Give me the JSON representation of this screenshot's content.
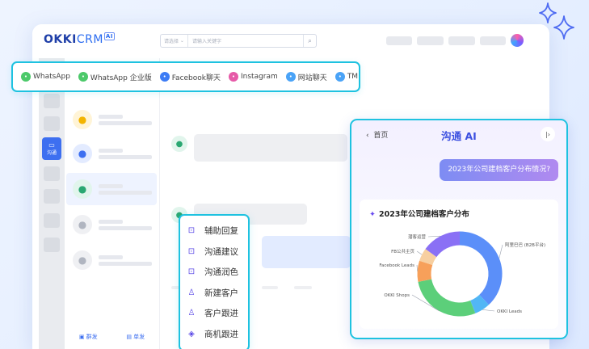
{
  "app": {
    "logo_main": "OKKI",
    "logo_suffix": "CRM",
    "logo_badge": "AI",
    "search": {
      "select_label": "请选择",
      "placeholder": "请输入关键字"
    }
  },
  "sidebar": {
    "active_label": "沟通"
  },
  "list_footer": {
    "group_send": "群发",
    "single_send": "单发"
  },
  "channels": [
    {
      "label": "WhatsApp",
      "color": "#4cc96a",
      "icon": "whatsapp-icon"
    },
    {
      "label": "WhatsApp 企业版",
      "color": "#4cc96a",
      "icon": "whatsapp-business-icon"
    },
    {
      "label": "Facebook聊天",
      "color": "#3d7cf5",
      "icon": "facebook-icon"
    },
    {
      "label": "Instagram",
      "color": "#e65aa8",
      "icon": "instagram-icon"
    },
    {
      "label": "网站聊天",
      "color": "#4aa3f7",
      "icon": "website-chat-icon"
    },
    {
      "label": "TM",
      "color": "#4aa3f7",
      "icon": "tm-icon"
    }
  ],
  "menu": [
    {
      "label": "辅助回复",
      "icon": "assist-reply-icon",
      "glyph": "⊡"
    },
    {
      "label": "沟通建议",
      "icon": "suggestion-icon",
      "glyph": "⊡"
    },
    {
      "label": "沟通润色",
      "icon": "polish-icon",
      "glyph": "⊡"
    },
    {
      "label": "新建客户",
      "icon": "new-customer-icon",
      "glyph": "♙"
    },
    {
      "label": "客户跟进",
      "icon": "customer-followup-icon",
      "glyph": "♙"
    },
    {
      "label": "商机跟进",
      "icon": "opportunity-icon",
      "glyph": "◈"
    }
  ],
  "ai_panel": {
    "back_label": "首页",
    "title": "沟通 AI",
    "question": "2023年公司建档客户分布情况?",
    "card_title": "2023年公司建档客户分布"
  },
  "chart_data": {
    "type": "pie",
    "title": "2023年公司建档客户分布",
    "labels": [
      "阿里巴巴 (B2B平台)",
      "OKKI Leads",
      "OKKI Shops",
      "Facebook Leads",
      "FB公共主页",
      "潜客运营"
    ],
    "values": [
      38,
      6,
      28,
      8,
      5,
      15
    ],
    "colors": [
      "#5b8ff9",
      "#52b6f5",
      "#5ccf7a",
      "#f7a05a",
      "#f7cfa0",
      "#8a70f5"
    ]
  }
}
